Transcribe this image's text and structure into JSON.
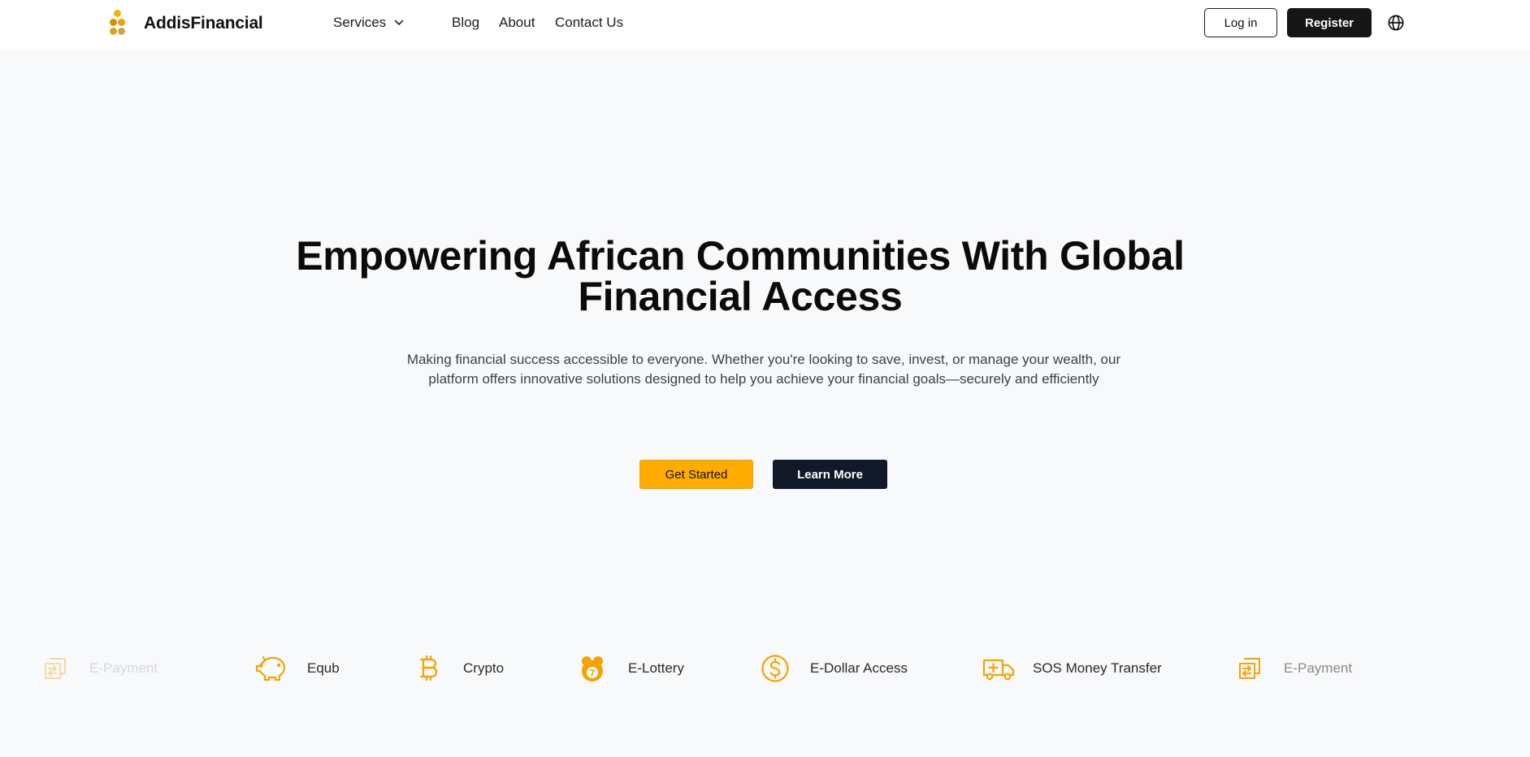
{
  "brand": {
    "name": "AddisFinancial",
    "logo_colors": [
      "#f5b400",
      "#e08c00",
      "#d9a21f",
      "#c8a94a"
    ]
  },
  "nav": {
    "services_label": "Services",
    "blog_label": "Blog",
    "about_label": "About",
    "contact_label": "Contact Us",
    "login_label": "Log in",
    "register_label": "Register",
    "language_icon": "globe-icon"
  },
  "hero": {
    "title_line1": "Empowering African Communities With Global",
    "title_line2": "Financial Access",
    "subtitle": "Making financial success accessible to everyone. Whether you're looking to save, invest, or manage your wealth, our platform offers innovative solutions designed to help you achieve your financial goals—securely and efficiently",
    "primary_cta": "Get Started",
    "secondary_cta": "Learn More"
  },
  "services": [
    {
      "label": "E-Payment",
      "icon": "transfer-icon",
      "faded": true
    },
    {
      "label": "Equb",
      "icon": "piggy-bank-icon",
      "faded": false
    },
    {
      "label": "Crypto",
      "icon": "bitcoin-icon",
      "faded": false
    },
    {
      "label": "E-Lottery",
      "icon": "lottery-ball-icon",
      "faded": false
    },
    {
      "label": "E-Dollar Access",
      "icon": "dollar-icon",
      "faded": false
    },
    {
      "label": "SOS Money Transfer",
      "icon": "ambulance-icon",
      "faded": false
    },
    {
      "label": "E-Payment",
      "icon": "transfer-icon",
      "faded": true
    }
  ],
  "colors": {
    "accent": "#ffab00",
    "dark_button": "#111827",
    "register_button": "#161616",
    "page_background": "#f8f9fb",
    "icon_orange": "#f5a300"
  }
}
